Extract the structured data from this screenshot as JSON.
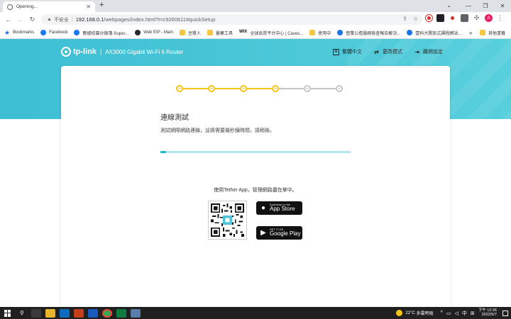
{
  "browser": {
    "tab_title": "Opening...",
    "new_tab": "+",
    "window_controls": [
      "⌄",
      "—",
      "❐",
      "✕"
    ],
    "nav": {
      "back": "←",
      "forward": "→",
      "reload": "↻"
    },
    "omnibox": {
      "security_icon": "warning-triangle-icon",
      "security_label": "不安全",
      "url_host": "192.168.0.1",
      "url_path": "/webpages/index.html?t=c9260611#quickSetup"
    },
    "avatar_letter": "A",
    "bookmarks": [
      {
        "label": "Bookmarks",
        "icon": "star-icon"
      },
      {
        "label": "Facebook",
        "icon": "facebook-icon"
      },
      {
        "label": "數據校園分錄簿-Super...",
        "icon": "facebook-icon"
      },
      {
        "label": "Web EIP - Main",
        "icon": "github-icon"
      },
      {
        "label": "豆漿人",
        "icon": "folder-icon"
      },
      {
        "label": "醫藥工具",
        "icon": "folder-icon"
      },
      {
        "label": "全球品質平台中心 | Caves...",
        "icon": "wix-icon"
      },
      {
        "label": "使用中",
        "icon": "folder-icon"
      },
      {
        "label": "營業公擔服務檢查報告解決...",
        "icon": "blue-globe-icon"
      },
      {
        "label": "壹科大開放式課程網站...",
        "icon": "blue-globe-icon"
      }
    ],
    "bookmarks_more": "»",
    "other_bookmarks": "其他書籤"
  },
  "router": {
    "brand": "tp-link",
    "model": "AX3000 Gigabit Wi-Fi 6 Router",
    "header_links": [
      {
        "label": "繁體中文",
        "icon": "language-icon"
      },
      {
        "label": "更改模式",
        "icon": "switch-mode-icon"
      },
      {
        "label": "離開設定",
        "icon": "exit-icon"
      }
    ]
  },
  "wizard": {
    "steps_total": 6,
    "steps_completed": 4,
    "title": "連線測試",
    "description": "測試網際網路連線，這將需要幾秒鐘時間，請稍後。",
    "progress": 0.03,
    "app_caption": "使用Tether App，管理網路盡在掌中。",
    "app_store": {
      "small": "Download on the",
      "big": "App Store"
    },
    "google_play": {
      "small": "GET IT ON",
      "big": "Google Play"
    }
  },
  "colors": {
    "accent": "#f5c518",
    "hero": "#3dbfd4",
    "progress": "#23b7c9",
    "progress_track": "#b3e7ee",
    "step_todo": "#c6c6c6"
  },
  "taskbar": {
    "temperature": "22°C",
    "weather": "多雲時陰",
    "ime": "中",
    "time": "下午 12:26",
    "date": "2022/5/7"
  }
}
